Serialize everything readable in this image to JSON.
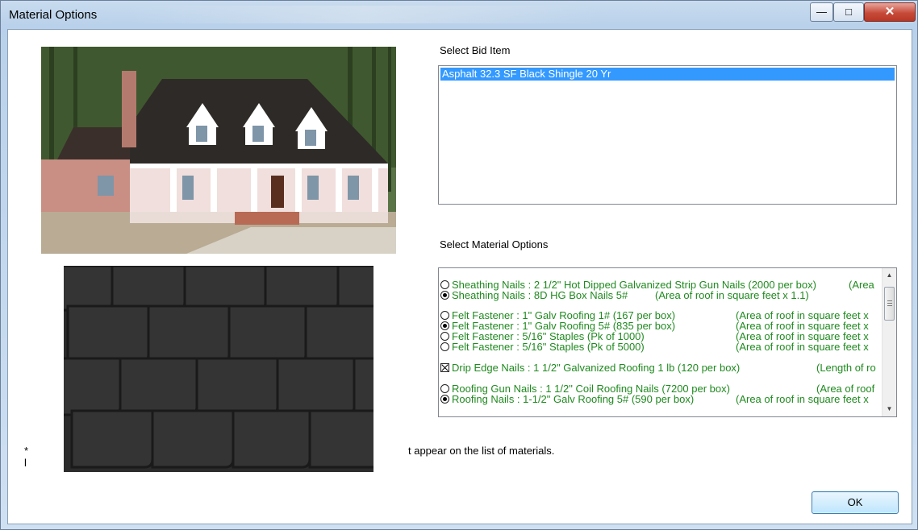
{
  "window": {
    "title": "Material Options"
  },
  "titlebar_controls": {
    "minimize_icon": "minimize-icon",
    "maximize_icon": "maximize-icon",
    "close_icon": "close-icon"
  },
  "bid_item": {
    "label": "Select Bid Item",
    "items": [
      "Asphalt 32.3 SF Black Shingle 20 Yr"
    ],
    "selected_index": 0
  },
  "material_options": {
    "label": "Select Material Options",
    "rows": [
      {
        "type": "radio",
        "checked": false,
        "text": "Sheathing Nails : 2 1/2\" Hot Dipped Galvanized Strip Gun Nails (2000 per box)",
        "area": "(Area"
      },
      {
        "type": "radio",
        "checked": true,
        "text": "Sheathing Nails : 8D HG Box Nails 5#",
        "area": "(Area of roof in square feet x 1.1)"
      },
      {
        "type": "radio",
        "checked": false,
        "text": "Felt Fastener : 1\" Galv Roofing 1# (167 per box)",
        "area": "(Area of roof in square feet x"
      },
      {
        "type": "radio",
        "checked": true,
        "text": "Felt Fastener : 1\" Galv Roofing 5# (835 per box)",
        "area": "(Area of roof in square feet x"
      },
      {
        "type": "radio",
        "checked": false,
        "text": "Felt Fastener : 5/16\" Staples (Pk of 1000)",
        "area": "(Area of roof in square feet x"
      },
      {
        "type": "radio",
        "checked": false,
        "text": "Felt Fastener : 5/16\" Staples (Pk of 5000)",
        "area": "(Area of roof in square feet x"
      },
      {
        "type": "check",
        "checked": true,
        "text": "Drip Edge Nails : 1 1/2\" Galvanized Roofing 1 lb (120 per box)",
        "area": "(Length of ro"
      },
      {
        "type": "radio",
        "checked": false,
        "text": "Roofing Gun Nails : 1 1/2\" Coil Roofing Nails (7200 per box)",
        "area": "(Area of roof"
      },
      {
        "type": "radio",
        "checked": true,
        "text": "Roofing Nails : 1-1/2\" Galv Roofing 5# (590 per box)",
        "area": "(Area of roof in square feet x"
      }
    ]
  },
  "notes": {
    "star": "*",
    "bar": "l",
    "line": "t appear on the list of materials."
  },
  "buttons": {
    "ok": "OK"
  }
}
